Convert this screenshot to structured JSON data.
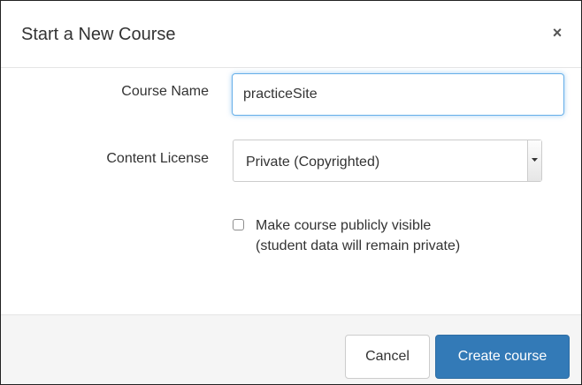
{
  "dialog": {
    "title": "Start a New Course",
    "close_label": "×"
  },
  "form": {
    "course_name_label": "Course Name",
    "course_name_value": "practiceSite",
    "license_label": "Content License",
    "license_value": "Private (Copyrighted)",
    "public_checkbox_checked": false,
    "public_line1": "Make course publicly visible",
    "public_line2": "(student data will remain private)"
  },
  "footer": {
    "cancel_label": "Cancel",
    "create_label": "Create course"
  },
  "colors": {
    "primary": "#337ab7",
    "focus_border": "#66afe9",
    "footer_bg": "#f5f5f5"
  }
}
